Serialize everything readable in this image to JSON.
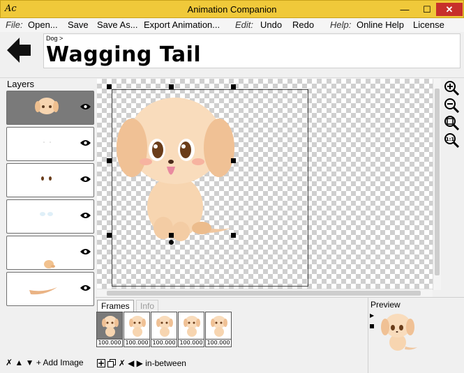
{
  "window": {
    "title": "Animation Companion",
    "min_label": "—",
    "max_label": "☐",
    "close_label": "✕",
    "app_icon_label": "Ac"
  },
  "menu": {
    "file_group": "File:",
    "open": "Open...",
    "save": "Save",
    "save_as": "Save As...",
    "export": "Export Animation...",
    "edit_group": "Edit:",
    "undo": "Undo",
    "redo": "Redo",
    "help_group": "Help:",
    "online_help": "Online Help",
    "license": "License"
  },
  "header": {
    "breadcrumb": "Dog >",
    "title": "Wagging Tail"
  },
  "layers": {
    "label": "Layers",
    "items": [
      {
        "name": "head",
        "selected": true
      },
      {
        "name": "eye highlights",
        "selected": false
      },
      {
        "name": "pupils",
        "selected": false
      },
      {
        "name": "eye whites",
        "selected": false
      },
      {
        "name": "body",
        "selected": false
      },
      {
        "name": "tail",
        "selected": false
      }
    ],
    "tools": {
      "delete": "✗",
      "up": "▲",
      "down": "▼",
      "add_image": "+ Add Image"
    }
  },
  "tabs": {
    "frames": "Frames",
    "info": "Info"
  },
  "frames": {
    "items": [
      {
        "time": "100.000",
        "selected": true
      },
      {
        "time": "100.000",
        "selected": false
      },
      {
        "time": "100.000",
        "selected": false
      },
      {
        "time": "100.000",
        "selected": false
      },
      {
        "time": "100.000",
        "selected": false
      }
    ],
    "tools": {
      "delete": "✗",
      "prev": "◀",
      "next": "▶",
      "inbetween": "in-between"
    }
  },
  "preview": {
    "label": "Preview"
  },
  "colors": {
    "titlebar": "#f0c93a",
    "close": "#c7302b",
    "dog_fur": "#f7d5b0",
    "dog_ear": "#eebf8f",
    "selected_bg": "#7a7a7a"
  }
}
